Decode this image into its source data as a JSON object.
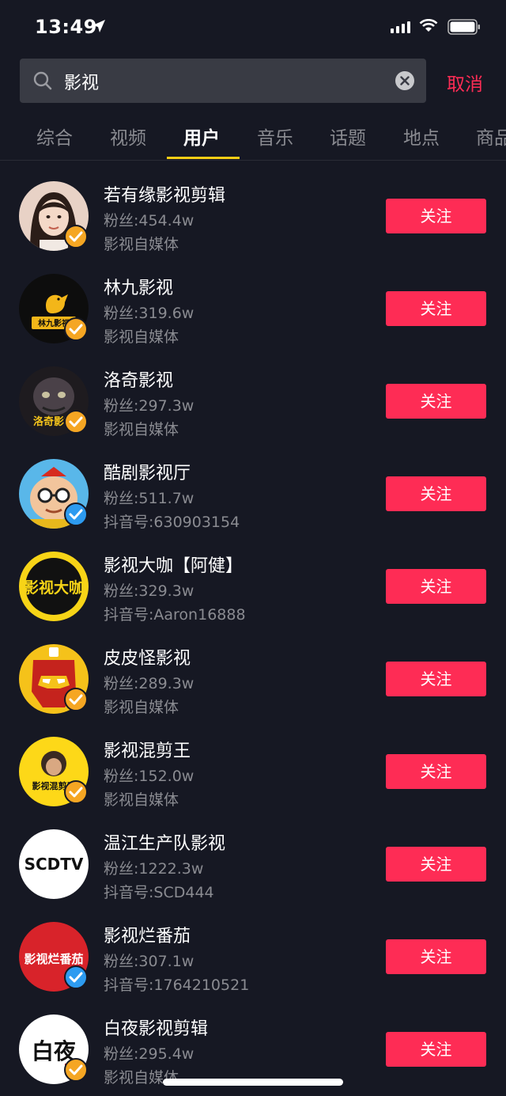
{
  "status_bar": {
    "time": "13:49"
  },
  "search": {
    "query": "影视",
    "cancel_label": "取消"
  },
  "tabs": [
    {
      "label": "综合",
      "active": false
    },
    {
      "label": "视频",
      "active": false
    },
    {
      "label": "用户",
      "active": true
    },
    {
      "label": "音乐",
      "active": false
    },
    {
      "label": "话题",
      "active": false
    },
    {
      "label": "地点",
      "active": false
    },
    {
      "label": "商品",
      "active": false
    }
  ],
  "colors": {
    "accent": "#fe2c55",
    "tab_indicator": "#face15",
    "badge_gold": "#f5a623",
    "badge_blue": "#2d9bf0",
    "background": "#161823"
  },
  "users": [
    {
      "name": "若有缘影视剪辑",
      "fans": "粉丝:454.4w",
      "desc": "影视自媒体",
      "follow": "关注",
      "badge": "gold",
      "avatar_icon": "woman-portrait-avatar"
    },
    {
      "name": "林九影视",
      "fans": "粉丝:319.6w",
      "desc": "影视自媒体",
      "follow": "关注",
      "badge": "gold",
      "avatar_icon": "bird-logo-avatar",
      "avatar_text": "林九影视"
    },
    {
      "name": "洛奇影视",
      "fans": "粉丝:297.3w",
      "desc": "影视自媒体",
      "follow": "关注",
      "badge": "gold",
      "avatar_icon": "creature-avatar",
      "avatar_text": "洛奇影视"
    },
    {
      "name": "酷剧影视厅",
      "fans": "粉丝:511.7w",
      "desc": "抖音号:630903154",
      "follow": "关注",
      "badge": "blue",
      "avatar_icon": "cartoon-face-avatar"
    },
    {
      "name": "影视大咖【阿健】",
      "fans": "粉丝:329.3w",
      "desc": "抖音号:Aaron16888",
      "follow": "关注",
      "badge": "none",
      "avatar_icon": "text-logo-avatar",
      "avatar_text": "影视大咖"
    },
    {
      "name": "皮皮怪影视",
      "fans": "粉丝:289.3w",
      "desc": "影视自媒体",
      "follow": "关注",
      "badge": "gold",
      "avatar_icon": "iron-mask-avatar"
    },
    {
      "name": "影视混剪王",
      "fans": "粉丝:152.0w",
      "desc": "影视自媒体",
      "follow": "关注",
      "badge": "gold",
      "avatar_icon": "film-maker-avatar",
      "avatar_text": "影视混剪王"
    },
    {
      "name": "温江生产队影视",
      "fans": "粉丝:1222.3w",
      "desc": "抖音号:SCD444",
      "follow": "关注",
      "badge": "none",
      "avatar_icon": "scdtv-logo-avatar",
      "avatar_text": "SCDTV"
    },
    {
      "name": "影视烂番茄",
      "fans": "粉丝:307.1w",
      "desc": "抖音号:1764210521",
      "follow": "关注",
      "badge": "blue",
      "avatar_icon": "tomato-logo-avatar",
      "avatar_text": "影视烂番茄"
    },
    {
      "name": "白夜影视剪辑",
      "fans": "粉丝:295.4w",
      "desc": "影视自媒体",
      "follow": "关注",
      "badge": "gold",
      "avatar_icon": "calligraphy-avatar",
      "avatar_text": "白夜"
    }
  ]
}
